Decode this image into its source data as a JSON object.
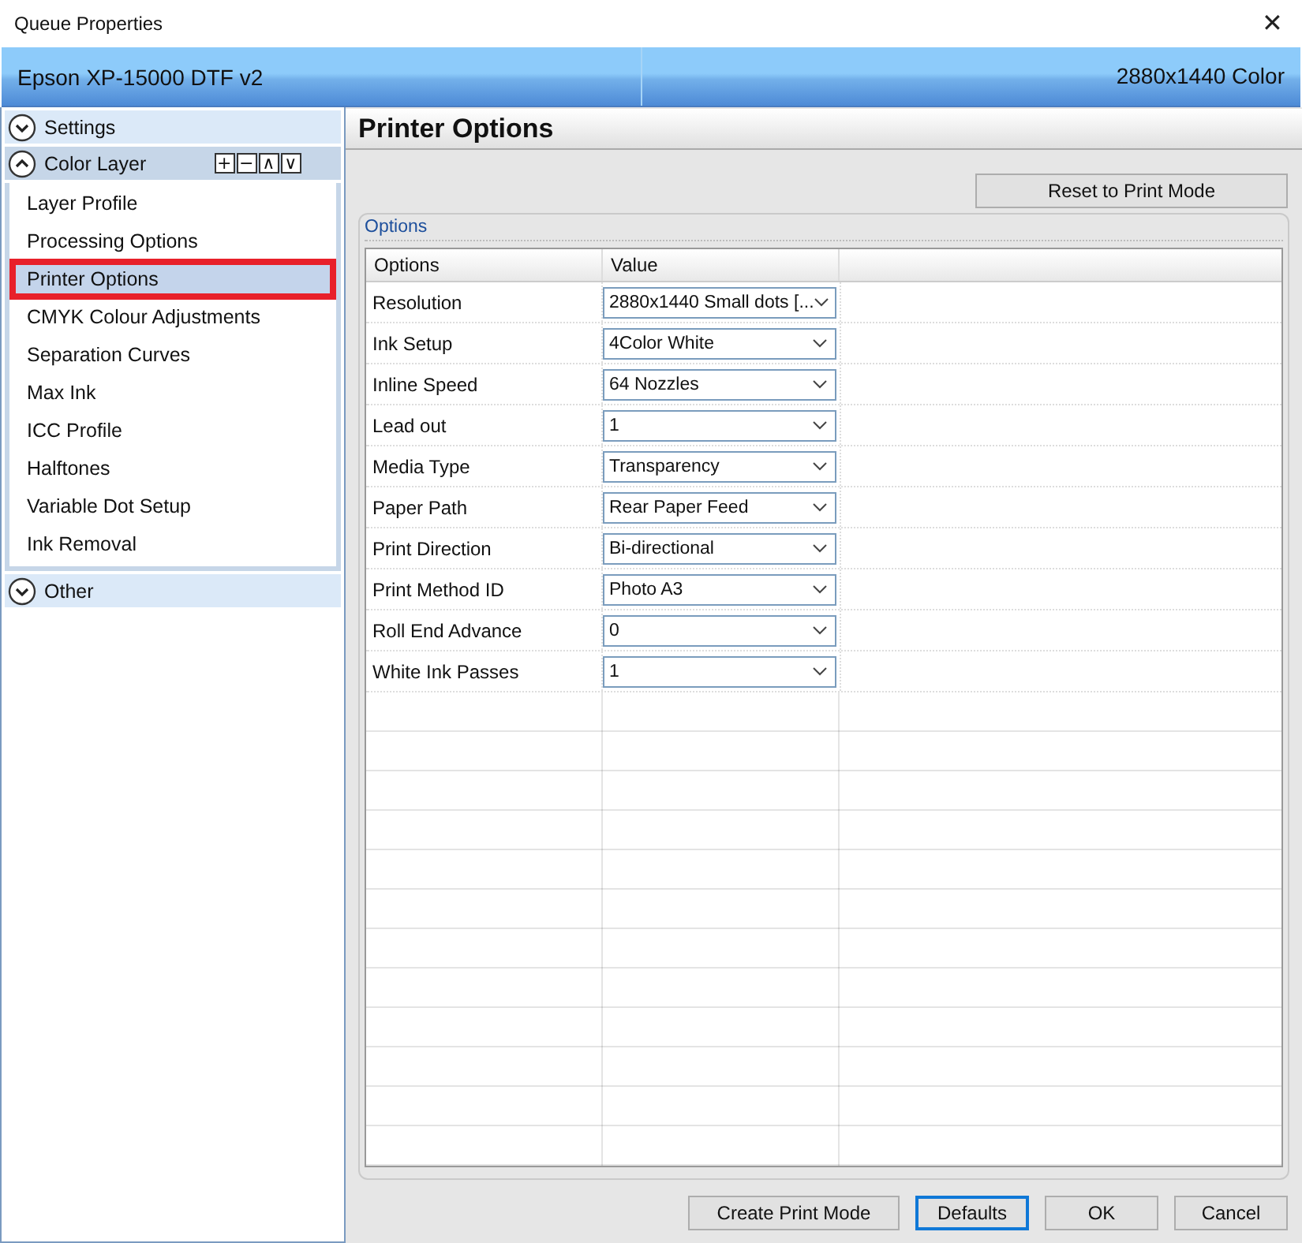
{
  "window": {
    "title": "Queue Properties",
    "close": "✕"
  },
  "header": {
    "printer": "Epson XP-15000 DTF v2",
    "mode": "2880x1440 Color"
  },
  "sidebar": {
    "groups": [
      {
        "label": "Settings",
        "expanded": false
      },
      {
        "label": "Color Layer",
        "expanded": true,
        "tools": [
          "+",
          "−",
          "∧",
          "∨"
        ],
        "items": [
          {
            "label": "Layer Profile",
            "selected": false
          },
          {
            "label": "Processing Options",
            "selected": false
          },
          {
            "label": "Printer Options",
            "selected": true
          },
          {
            "label": "CMYK Colour Adjustments",
            "selected": false
          },
          {
            "label": "Separation Curves",
            "selected": false
          },
          {
            "label": "Max Ink",
            "selected": false
          },
          {
            "label": "ICC Profile",
            "selected": false
          },
          {
            "label": "Halftones",
            "selected": false
          },
          {
            "label": "Variable Dot Setup",
            "selected": false
          },
          {
            "label": "Ink Removal",
            "selected": false
          }
        ]
      },
      {
        "label": "Other",
        "expanded": false
      }
    ]
  },
  "page": {
    "title": "Printer Options",
    "reset_button": "Reset to Print Mode",
    "group_title": "Options",
    "table": {
      "columns": [
        "Options",
        "Value"
      ],
      "rows": [
        {
          "option": "Resolution",
          "value": "2880x1440 Small dots [..."
        },
        {
          "option": "Ink Setup",
          "value": "4Color White"
        },
        {
          "option": "Inline Speed",
          "value": "64 Nozzles"
        },
        {
          "option": "Lead out",
          "value": "1"
        },
        {
          "option": "Media Type",
          "value": "Transparency"
        },
        {
          "option": "Paper Path",
          "value": "Rear Paper Feed"
        },
        {
          "option": "Print Direction",
          "value": "Bi-directional"
        },
        {
          "option": "Print Method ID",
          "value": "Photo A3"
        },
        {
          "option": "Roll End Advance",
          "value": "0"
        },
        {
          "option": "White Ink Passes",
          "value": "1"
        }
      ]
    }
  },
  "buttons": [
    {
      "label": "Create Print Mode",
      "focused": false
    },
    {
      "label": "Defaults",
      "focused": true
    },
    {
      "label": "OK",
      "focused": false
    },
    {
      "label": "Cancel",
      "focused": false
    }
  ]
}
